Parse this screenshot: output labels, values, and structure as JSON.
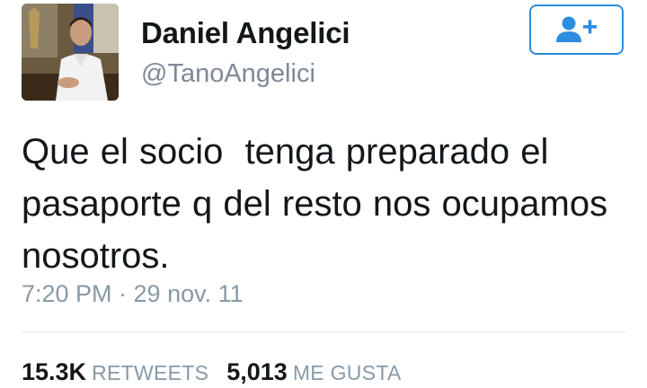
{
  "user": {
    "display_name": "Daniel Angelici",
    "handle": "@TanoAngelici",
    "avatar": "avatar-photo"
  },
  "follow_button": {
    "icon": "add-user-icon"
  },
  "tweet": {
    "text": "Que el socio  tenga preparado el\npasaporte q del resto nos ocupamos\nnosotros.",
    "timestamp": "7:20 PM · 29 nov. 11"
  },
  "stats": {
    "retweets_count": "15.3K",
    "retweets_label": "RETWEETS",
    "likes_count": "5,013",
    "likes_label": "ME GUSTA"
  },
  "colors": {
    "accent": "#2b8ce0",
    "secondary_text": "#8899a6",
    "primary_text": "#14171a"
  }
}
